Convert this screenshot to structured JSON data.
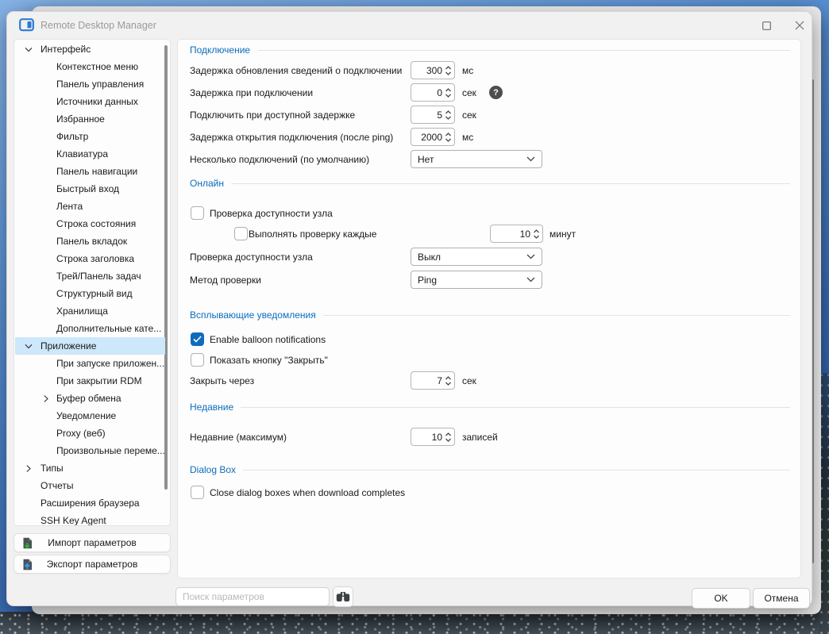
{
  "window": {
    "title": "Remote Desktop Manager"
  },
  "sidebar": {
    "items": [
      {
        "label": "Интерфейс",
        "level": 0,
        "chevron": "down",
        "selected": false
      },
      {
        "label": "Контекстное меню",
        "level": 1
      },
      {
        "label": "Панель управления",
        "level": 1
      },
      {
        "label": "Источники данных",
        "level": 1
      },
      {
        "label": "Избранное",
        "level": 1
      },
      {
        "label": "Фильтр",
        "level": 1
      },
      {
        "label": "Клавиатура",
        "level": 1
      },
      {
        "label": "Панель навигации",
        "level": 1
      },
      {
        "label": "Быстрый вход",
        "level": 1
      },
      {
        "label": "Лента",
        "level": 1
      },
      {
        "label": "Строка состояния",
        "level": 1
      },
      {
        "label": "Панель вкладок",
        "level": 1
      },
      {
        "label": "Строка заголовка",
        "level": 1
      },
      {
        "label": "Трей/Панель задач",
        "level": 1
      },
      {
        "label": "Структурный вид",
        "level": 1
      },
      {
        "label": "Хранилища",
        "level": 1
      },
      {
        "label": "Дополнительные кате...",
        "level": 1
      },
      {
        "label": "Приложение",
        "level": 0,
        "chevron": "down",
        "selected": true
      },
      {
        "label": "При запуске приложен...",
        "level": 1
      },
      {
        "label": "При закрытии RDM",
        "level": 1
      },
      {
        "label": "Буфер обмена",
        "level": 1,
        "chevron": "right"
      },
      {
        "label": "Уведомление",
        "level": 1
      },
      {
        "label": "Proxy (веб)",
        "level": 1
      },
      {
        "label": "Произвольные переме...",
        "level": 1
      },
      {
        "label": "Типы",
        "level": 0,
        "chevron": "right"
      },
      {
        "label": "Отчеты",
        "level": 0
      },
      {
        "label": "Расширения браузера",
        "level": 0
      },
      {
        "label": "SSH Key Agent",
        "level": 0
      }
    ],
    "import_button": "Импорт параметров",
    "export_button": "Экспорт параметров"
  },
  "sections": {
    "connection": {
      "title": "Подключение",
      "rows": [
        {
          "label": "Задержка обновления сведений о подключении",
          "value": "300",
          "unit": "мс"
        },
        {
          "label": "Задержка при подключении",
          "value": "0",
          "unit": "сек"
        },
        {
          "label": "Подключить при доступной задержке",
          "value": "5",
          "unit": "сек"
        },
        {
          "label": "Задержка открытия подключения (после ping)",
          "value": "2000",
          "unit": "мс"
        },
        {
          "label": "Несколько подключений (по умолчанию)",
          "value": "Нет"
        }
      ]
    },
    "online": {
      "title": "Онлайн",
      "check_host": "Проверка доступности узла",
      "check_interval": "Выполнять проверку каждые",
      "interval_value": "10",
      "interval_unit": "минут",
      "host_check_label": "Проверка доступности узла",
      "host_check_value": "Выкл",
      "method_label": "Метод проверки",
      "method_value": "Ping"
    },
    "balloon": {
      "title": "Всплывающие уведомления",
      "check_enable": "Enable balloon notifications",
      "check_close": "Показать кнопку \"Закрыть\"",
      "close_after_label": "Закрыть через",
      "close_after_value": "7",
      "close_after_unit": "сек"
    },
    "recent": {
      "title": "Недавние",
      "label": "Недавние (максимум)",
      "value": "10",
      "unit": "записей"
    },
    "dialog_box": {
      "title": "Dialog Box",
      "check": "Close dialog boxes when download completes"
    }
  },
  "footer": {
    "search_placeholder": "Поиск параметров",
    "ok": "OK",
    "cancel": "Отмена"
  }
}
